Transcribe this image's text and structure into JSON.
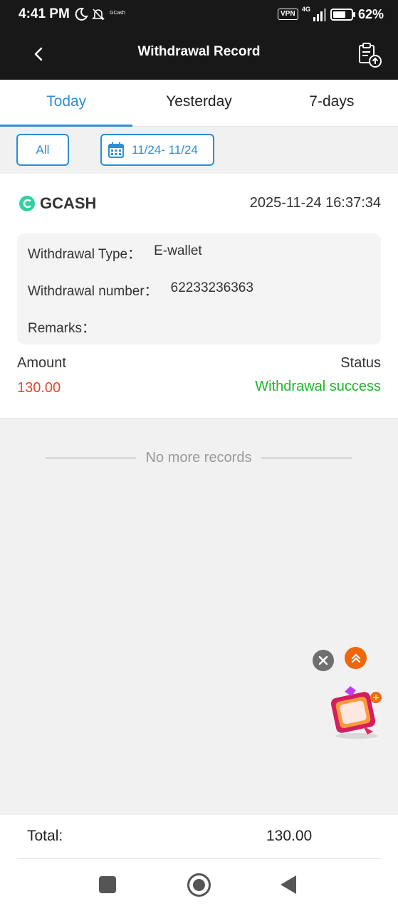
{
  "status_bar": {
    "time": "4:41 PM",
    "app_notification": "GCash",
    "vpn": "VPN",
    "network": "4G",
    "battery": "62%"
  },
  "header": {
    "title": "Withdrawal Record",
    "back_icon": "chevron-left-icon",
    "export_icon": "clipboard-upload-icon"
  },
  "tabs": [
    {
      "label": "Today",
      "active": true
    },
    {
      "label": "Yesterday",
      "active": false
    },
    {
      "label": "7-days",
      "active": false
    }
  ],
  "filters": {
    "all_label": "All",
    "date_range": "11/24- 11/24",
    "calendar_icon": "calendar-icon"
  },
  "record": {
    "brand": "GCASH",
    "datetime": "2025-11-24 16:37:34",
    "details": [
      {
        "label": "Withdrawal Type：",
        "value": "E-wallet"
      },
      {
        "label": "Withdrawal number：",
        "value": "62233236363"
      },
      {
        "label": "Remarks：",
        "value": ""
      }
    ],
    "amount_label": "Amount",
    "amount_value": "130.00",
    "status_label": "Status",
    "status_value": "Withdrawal success"
  },
  "no_more_text": "No more records",
  "total": {
    "label": "Total:",
    "value": "130.00"
  },
  "colors": {
    "accent": "#2a8fd6",
    "amount": "#e4462c",
    "success": "#1fb52c",
    "header_bg": "#181818"
  }
}
